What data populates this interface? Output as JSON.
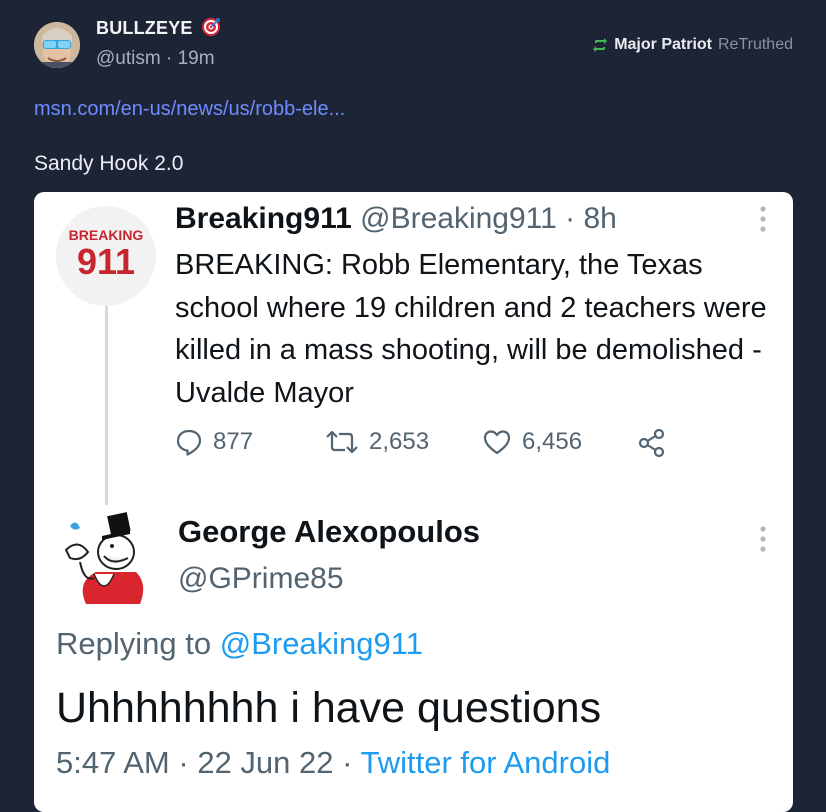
{
  "post": {
    "author_name": "BULLZEYE",
    "author_badge_icon": "target-icon",
    "handle": "@utism",
    "separator": "·",
    "age": "19m",
    "retruth": {
      "icon": "retruth-icon",
      "by": "Major Patriot",
      "verb": "ReTruthed"
    },
    "link_text": "msn.com/en-us/news/us/robb-ele...",
    "text": "Sandy Hook 2.0"
  },
  "embedded_screenshot": {
    "tweet1": {
      "logo_text_top": "BREAKING",
      "logo_text_number": "911",
      "display_name": "Breaking911",
      "handle": "@Breaking911",
      "separator": "·",
      "age": "8h",
      "body": "BREAKING: Robb Elementary, the Texas school where 19 children and 2 teachers were killed in a mass shooting, will be demolished - Uvalde Mayor",
      "replies": "877",
      "retweets": "2,653",
      "likes": "6,456"
    },
    "tweet2": {
      "display_name": "George Alexopoulos",
      "handle": "@GPrime85",
      "replying_prefix": "Replying to",
      "replying_to": "@Breaking911",
      "body": "Uhhhhhhhh i have questions",
      "time": "5:47 AM",
      "date": "22 Jun 22",
      "separator": "·",
      "source": "Twitter for Android"
    }
  },
  "colors": {
    "background": "#1d2435",
    "link": "#6e8cff",
    "retruth_green": "#3fb950",
    "twitter_blue": "#1d9bf0",
    "breaking_red": "#c8262f"
  }
}
